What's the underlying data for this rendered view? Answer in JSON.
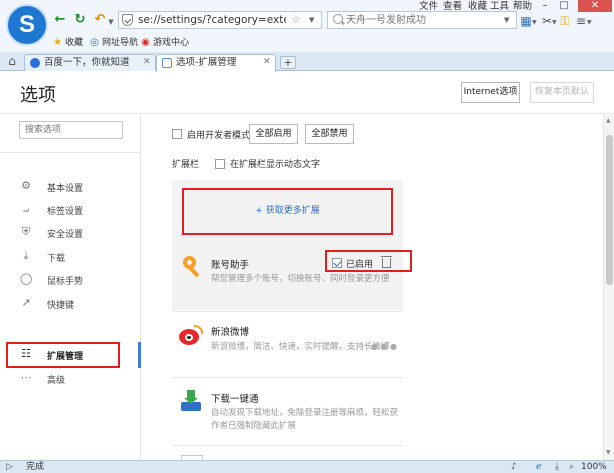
{
  "browser": {
    "logo_letter": "S",
    "address": "se://settings/?category=extension",
    "search_placeholder": "天舟一号发射成功",
    "menu": [
      "文件",
      "查看",
      "收藏",
      "工具",
      "帮助"
    ],
    "favorites": [
      "收藏",
      "网址导航",
      "游戏中心"
    ],
    "tabs": [
      {
        "label": "百度一下，你就知道",
        "active": false
      },
      {
        "label": "选项-扩展管理",
        "active": true
      }
    ]
  },
  "page": {
    "title": "选项",
    "ie_button": "Internet选项",
    "reset_button": "恢复本页默认",
    "search_placeholder": "搜索选项"
  },
  "sidebar": {
    "items": [
      {
        "label": "基本设置",
        "icon": "gear-icon",
        "active": false
      },
      {
        "label": "标签设置",
        "icon": "tab-icon",
        "active": false
      },
      {
        "label": "安全设置",
        "icon": "shield-icon",
        "active": false
      },
      {
        "label": "下载",
        "icon": "download-icon",
        "active": false
      },
      {
        "label": "鼠标手势",
        "icon": "mouse-icon",
        "active": false
      },
      {
        "label": "快捷键",
        "icon": "shortcut-icon",
        "active": false
      },
      {
        "label": "扩展管理",
        "icon": "extensions-icon",
        "active": true
      },
      {
        "label": "高级",
        "icon": "more-icon",
        "active": false
      }
    ]
  },
  "content": {
    "dev_mode_label": "启用开发者模式",
    "enable_all": "全部启用",
    "disable_all": "全部禁用",
    "extbar_label": "扩展栏",
    "dynamic_text_label": "在扩展栏显示动态文字",
    "get_more": "+ 获取更多扩展",
    "extensions": [
      {
        "name": "账号助手",
        "desc": "帮您管理多个账号，切换账号、同时登录更方便",
        "status": "已启用",
        "icon": "key-icon"
      },
      {
        "name": "新浪微博",
        "desc": "新浪微博，简洁、快速，实时提醒，支持长微博",
        "more": "● ● ●",
        "icon": "weibo-icon"
      },
      {
        "name": "下载一键通",
        "desc": "自动发现下载地址，免除登录注册等麻烦，轻松获",
        "desc2": "作者已强制隐藏此扩展",
        "icon": "download-all-icon"
      }
    ]
  },
  "status": {
    "text": "完成",
    "zoom": "100%"
  },
  "colors": {
    "accent": "#3a7fd4",
    "link": "#2f6fc9",
    "highlight": "#e02020"
  }
}
